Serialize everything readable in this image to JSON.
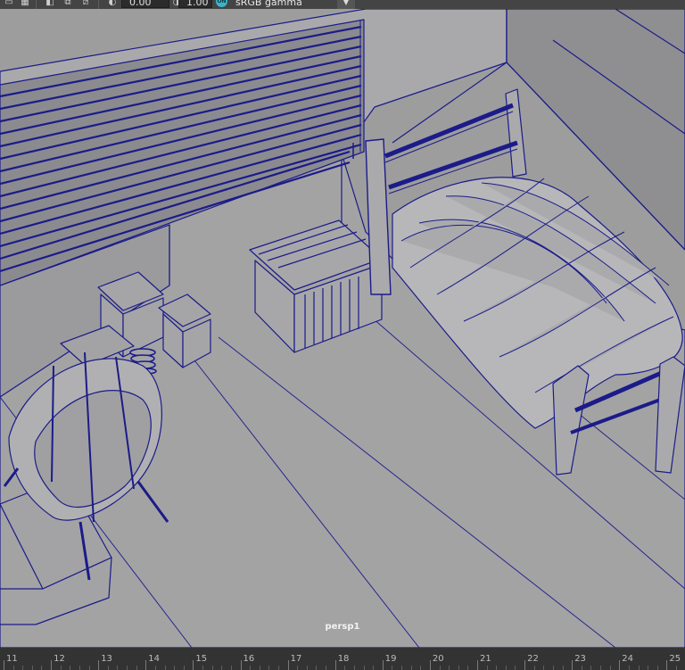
{
  "toolbar": {
    "exposure_value": "0.00",
    "gamma_value": "1.00",
    "color_management_badge": "ON",
    "color_space_label": "sRGB gamma",
    "icons": [
      "select-icon",
      "grid-icon",
      "snap-icon",
      "frame-icon",
      "exposure-icon",
      "color-management-icon"
    ]
  },
  "viewport": {
    "camera_label": "persp1",
    "background_color": "#9d9d9d",
    "wireframe_color": "#1b1b8a"
  },
  "timeline": {
    "ticks": [
      "11",
      "12",
      "13",
      "14",
      "15",
      "16",
      "17",
      "18",
      "19",
      "20",
      "21",
      "22",
      "23",
      "24",
      "25"
    ]
  }
}
